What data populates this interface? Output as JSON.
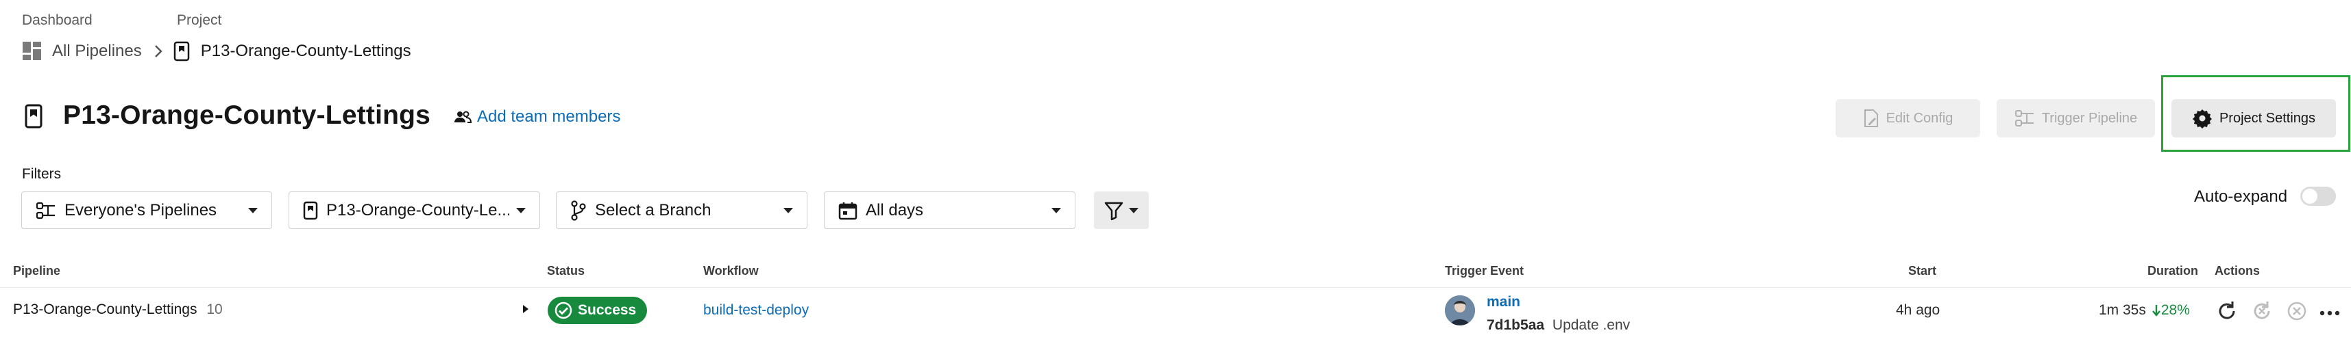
{
  "breadcrumb": {
    "dashboard_label": "Dashboard",
    "project_label": "Project",
    "all_pipelines": "All Pipelines",
    "project_name": "P13-Orange-County-Lettings"
  },
  "header": {
    "title": "P13-Orange-County-Lettings",
    "add_team_members": "Add team members",
    "edit_config": "Edit Config",
    "trigger_pipeline": "Trigger Pipeline",
    "project_settings": "Project Settings"
  },
  "filters": {
    "label": "Filters",
    "pipelines_filter": "Everyone's Pipelines",
    "project_filter": "P13-Orange-County-Le...",
    "branch_filter": "Select a Branch",
    "date_filter": "All days",
    "auto_expand": "Auto-expand"
  },
  "table": {
    "columns": {
      "pipeline": "Pipeline",
      "status": "Status",
      "workflow": "Workflow",
      "trigger_event": "Trigger Event",
      "start": "Start",
      "duration": "Duration",
      "actions": "Actions"
    },
    "rows": [
      {
        "pipeline": "P13-Orange-County-Lettings",
        "number": "10",
        "status": "Success",
        "workflow": "build-test-deploy",
        "branch": "main",
        "commit": "7d1b5aa",
        "commit_message": "Update .env",
        "start": "4h ago",
        "duration": "1m 35s",
        "duration_change": "28%"
      }
    ]
  },
  "colors": {
    "accent_link": "#0b6cb8",
    "success": "#178a3e",
    "highlight": "#2aa33c"
  }
}
